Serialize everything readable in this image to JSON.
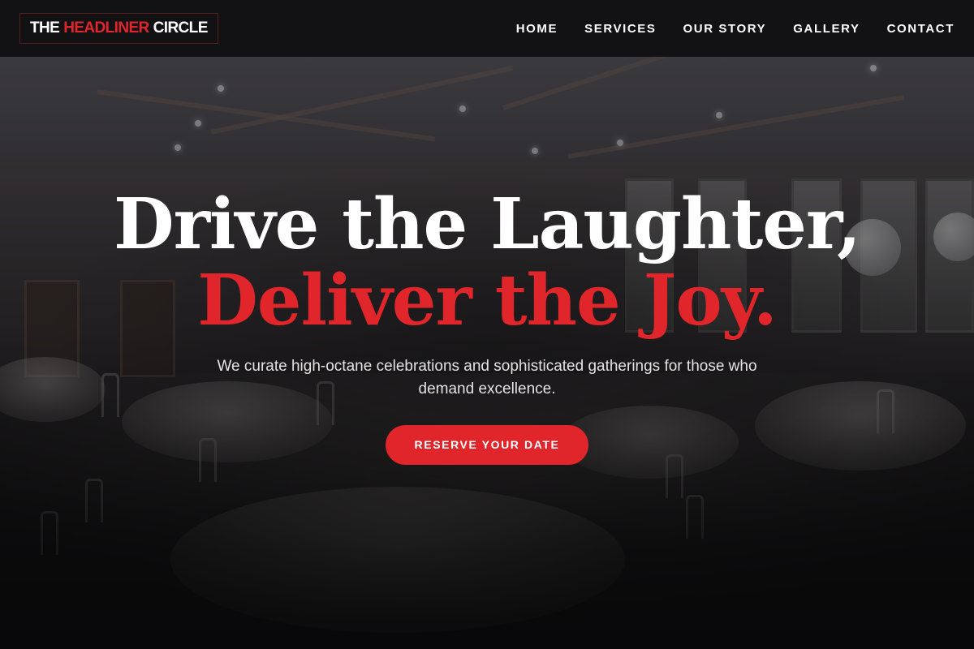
{
  "brand": {
    "logo_part1": "THE",
    "logo_part2": "HEADLINER",
    "logo_part3": "CIRCLE",
    "accent_color": "#e0262b"
  },
  "nav": {
    "items": [
      {
        "label": "HOME"
      },
      {
        "label": "SERVICES"
      },
      {
        "label": "OUR STORY"
      },
      {
        "label": "GALLERY"
      },
      {
        "label": "CONTACT"
      }
    ]
  },
  "hero": {
    "headline_line1": "Drive the Laughter,",
    "headline_line2": "Deliver the Joy.",
    "subtitle": "We curate high-octane celebrations and sophisticated gatherings for those who demand excellence.",
    "cta_label": "RESERVE YOUR DATE",
    "background_image": "event-hall-photo"
  }
}
